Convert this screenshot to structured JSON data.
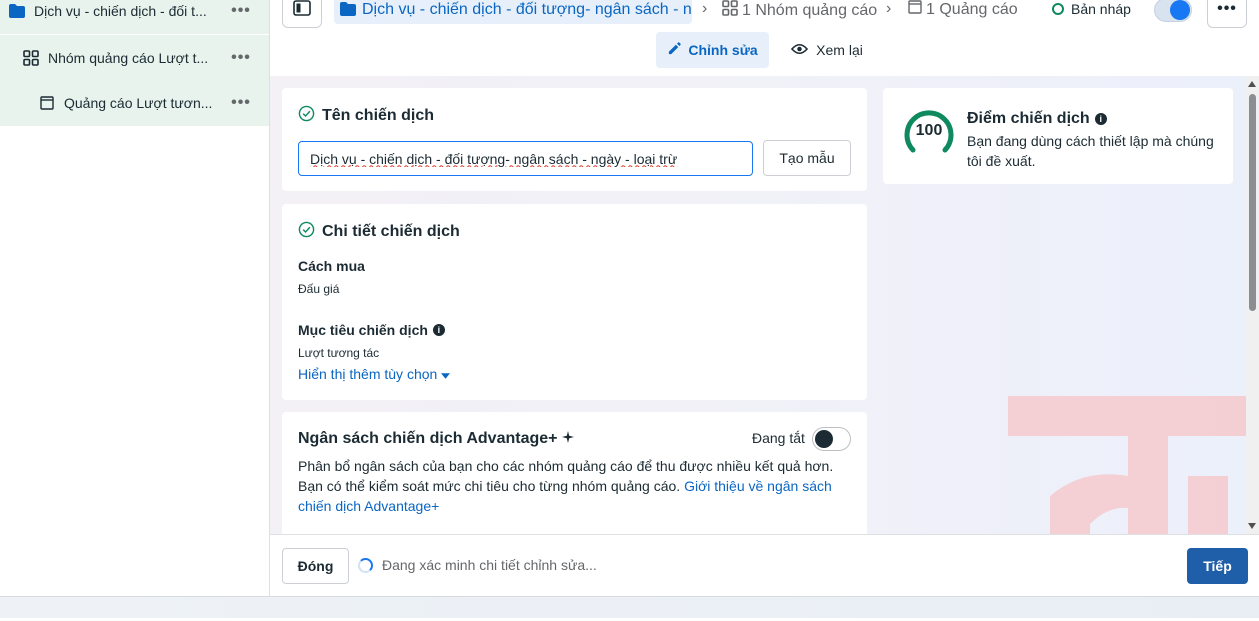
{
  "sidebar": {
    "items": [
      {
        "label": "Dịch vụ - chiến dịch - đối t...",
        "icon": "folder-icon",
        "more": "•••"
      },
      {
        "label": "Nhóm quảng cáo Lượt t...",
        "icon": "grid-icon",
        "more": "•••"
      },
      {
        "label": "Quảng cáo Lượt tươn...",
        "icon": "ad-page-icon",
        "more": "•••"
      }
    ]
  },
  "topbar": {
    "breadcrumb_campaign": "Dịch vụ - chiến dịch - đối tượng- ngân sách - ngà",
    "breadcrumb_adsets": "1 Nhóm quảng cáo",
    "breadcrumb_ads": "1 Quảng cáo",
    "draft_label": "Bản nháp",
    "more": "•••",
    "tab_edit": "Chỉnh sửa",
    "tab_review": "Xem lại"
  },
  "campaign_name": {
    "title": "Tên chiến dịch",
    "value": "Dịch vụ - chiến dịch - đối tượng- ngân sách - ngày - loại trừ",
    "template_button": "Tạo mẫu"
  },
  "details": {
    "title": "Chi tiết chiến dịch",
    "buying_label": "Cách mua",
    "buying_value": "Đấu giá",
    "objective_label": "Mục tiêu chiến dịch",
    "objective_value": "Lượt tương tác",
    "more_options": "Hiển thị thêm tùy chọn"
  },
  "advantage": {
    "title": "Ngân sách chiến dịch Advantage+",
    "status": "Đang tắt",
    "desc": "Phân bổ ngân sách của bạn cho các nhóm quảng cáo để thu được nhiều kết quả hơn. Bạn có thể kiểm soát mức chi tiêu cho từng nhóm quảng cáo. ",
    "link": "Giới thiệu về ngân sách chiến dịch Advantage+"
  },
  "score": {
    "value": "100",
    "percent": 100,
    "title": "Điểm chiến dịch",
    "desc": "Bạn đang dùng cách thiết lập mà chúng tôi đề xuất."
  },
  "footer": {
    "close_button": "Đóng",
    "status": "Đang xác minh chi tiết chỉnh sửa...",
    "next_button": "Tiếp"
  },
  "colors": {
    "accent": "#1877f2",
    "link": "#0a66c2",
    "success": "#0f8a5f",
    "watermark": "#f5c9cc"
  }
}
